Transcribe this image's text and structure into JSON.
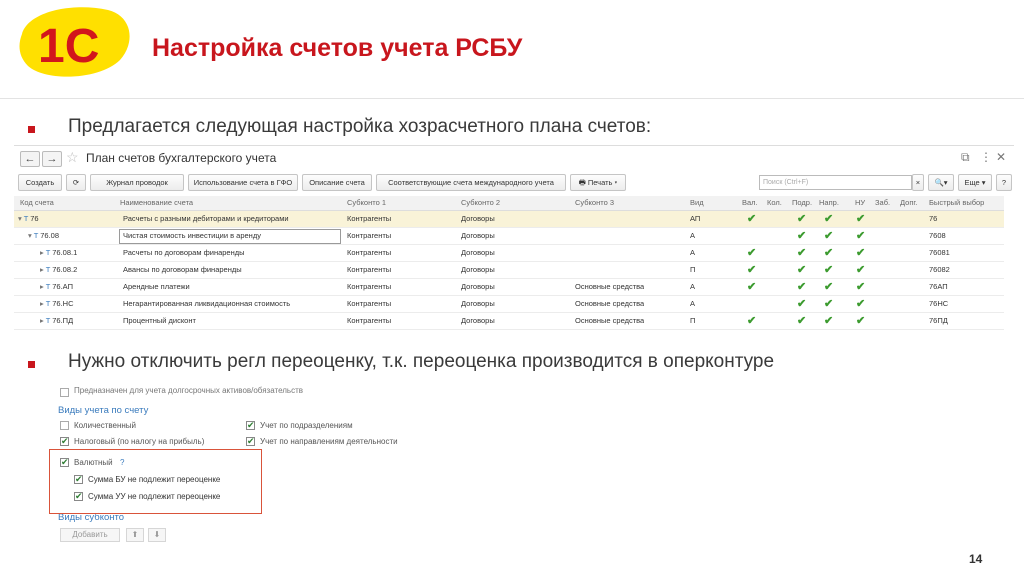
{
  "slide": {
    "title": "Настройка счетов учета РСБУ",
    "bullet1": "Предлагается следующая настройка хозрасчетного плана счетов:",
    "bullet2": "Нужно отключить регл переоценку, т.к. переоценка производится в оперконтуре",
    "page_number": "14",
    "accent_color": "#c8161d"
  },
  "logo": {
    "text": "1С",
    "bg_color": "#ffe000",
    "fg_color": "#d2161c"
  },
  "window": {
    "title": "План счетов бухгалтерского учета",
    "controls": [
      "⧉",
      "⋮",
      "✕"
    ],
    "toolbar": {
      "create": "Создать",
      "journal": "Журнал проводок",
      "usage": "Использование счета в ГФО",
      "description": "Описание счета",
      "intl": "Соответствующие счета международного учета",
      "print": "Печать",
      "search_placeholder": "Поиск (Ctrl+F)",
      "more": "Еще"
    },
    "columns": [
      "Код счета",
      "Наименование счета",
      "Субконто 1",
      "Субконто 2",
      "Субконто 3",
      "Вид",
      "Вал.",
      "Кол.",
      "Подр.",
      "Напр.",
      "НУ",
      "Заб.",
      "Допг.",
      "Быстрый выбор"
    ],
    "rows": [
      {
        "code": "76",
        "name": "Расчеты с разными дебиторами и кредиторами",
        "sub1": "Контрагенты",
        "sub2": "Договоры",
        "sub3": "",
        "vid": "АП",
        "val": true,
        "kol": false,
        "podr": true,
        "napr": true,
        "nu": true,
        "fast": "76",
        "level": 0
      },
      {
        "code": "76.08",
        "name": "Чистая стоимость инвестиции в аренду",
        "sub1": "Контрагенты",
        "sub2": "Договоры",
        "sub3": "",
        "vid": "А",
        "val": false,
        "kol": false,
        "podr": true,
        "napr": true,
        "nu": true,
        "fast": "7608",
        "level": 1
      },
      {
        "code": "76.08.1",
        "name": "Расчеты по договорам финаренды",
        "sub1": "Контрагенты",
        "sub2": "Договоры",
        "sub3": "",
        "vid": "А",
        "val": true,
        "kol": false,
        "podr": true,
        "napr": true,
        "nu": true,
        "fast": "76081",
        "level": 2
      },
      {
        "code": "76.08.2",
        "name": "Авансы по договорам финаренды",
        "sub1": "Контрагенты",
        "sub2": "Договоры",
        "sub3": "",
        "vid": "П",
        "val": true,
        "kol": false,
        "podr": true,
        "napr": true,
        "nu": true,
        "fast": "76082",
        "level": 2
      },
      {
        "code": "76.АП",
        "name": "Арендные платежи",
        "sub1": "Контрагенты",
        "sub2": "Договоры",
        "sub3": "Основные средства",
        "vid": "А",
        "val": true,
        "kol": false,
        "podr": true,
        "napr": true,
        "nu": true,
        "fast": "76АП",
        "level": 2
      },
      {
        "code": "76.НС",
        "name": "Негарантированная ликвидационная стоимость",
        "sub1": "Контрагенты",
        "sub2": "Договоры",
        "sub3": "Основные средства",
        "vid": "А",
        "val": false,
        "kol": false,
        "podr": true,
        "napr": true,
        "nu": true,
        "fast": "76НС",
        "level": 2
      },
      {
        "code": "76.ПД",
        "name": "Процентный дисконт",
        "sub1": "Контрагенты",
        "sub2": "Договоры",
        "sub3": "Основные средства",
        "vid": "П",
        "val": true,
        "kol": false,
        "podr": true,
        "napr": true,
        "nu": true,
        "fast": "76ПД",
        "level": 2
      }
    ]
  },
  "settings": {
    "top_label": "Предназначен для учета долгосрочных активов/обязательств",
    "types_title": "Виды учета по счету",
    "quantitative": "Количественный",
    "by_division": "Учет по подразделениям",
    "tax": "Налоговый (по налогу на прибыль)",
    "by_direction": "Учет по направлениям деятельности",
    "currency": "Валютный",
    "currency_hint": "?",
    "bu_no_reval": "Сумма БУ не подлежит переоценке",
    "uu_no_reval": "Сумма УУ не подлежит переоценке",
    "subconto_title": "Виды субконто",
    "add": "Добавить",
    "up": "⬆",
    "down": "⬇"
  }
}
